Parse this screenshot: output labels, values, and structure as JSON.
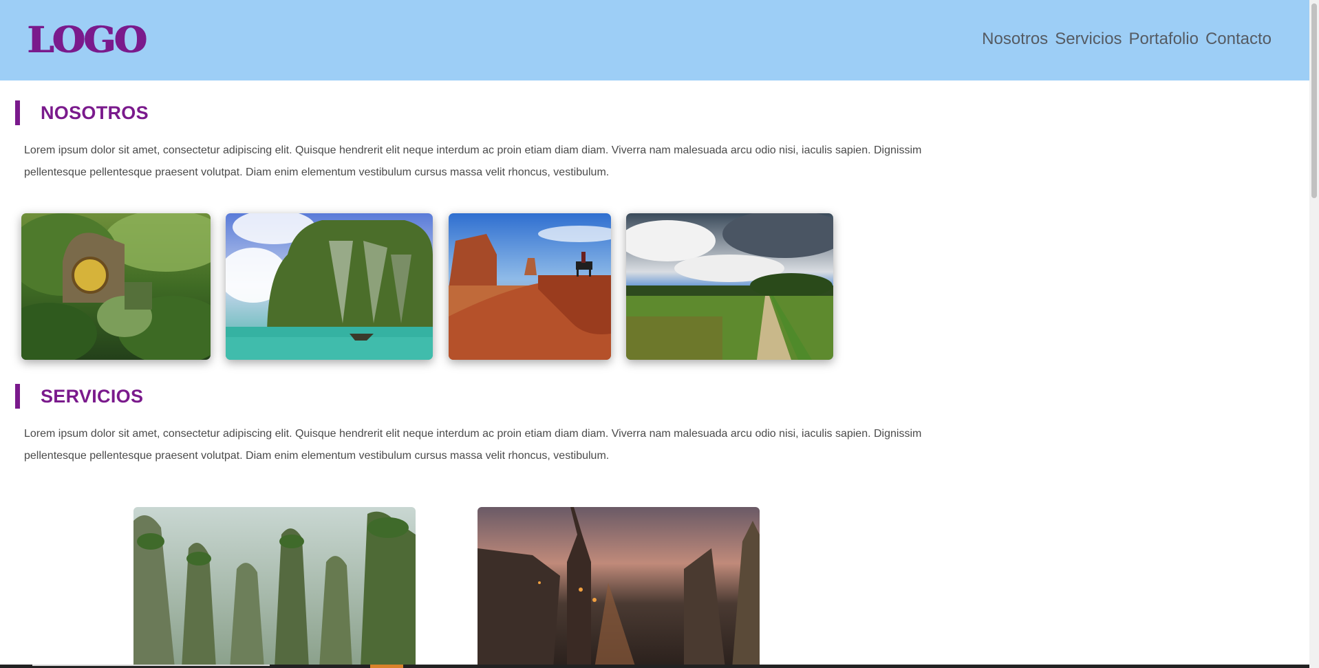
{
  "header": {
    "logo": "LOGO",
    "nav": [
      "Nosotros",
      "Servicios",
      "Portafolio",
      "Contacto"
    ]
  },
  "nosotros": {
    "title": "NOSOTROS",
    "text": "Lorem ipsum dolor sit amet, consectetur adipiscing elit. Quisque hendrerit elit neque interdum ac proin etiam diam diam. Viverra nam malesuada arcu odio nisi, iaculis sapien. Dignissim pellentesque pellentesque praesent volutpat. Diam enim elementum vestibulum cursus massa velit rhoncus, vestibulum."
  },
  "servicios": {
    "title": "SERVICIOS",
    "text": "Lorem ipsum dolor sit amet, consectetur adipiscing elit. Quisque hendrerit elit neque interdum ac proin etiam diam diam. Viverra nam malesuada arcu odio nisi, iaculis sapien. Dignissim pellentesque pellentesque praesent volutpat. Diam enim elementum vestibulum cursus massa velit rhoncus, vestibulum."
  },
  "colors": {
    "header_bg": "#9dcef6",
    "accent": "#7a1a8c",
    "nav_text": "#555b63",
    "body_text": "#4a4a4a"
  }
}
